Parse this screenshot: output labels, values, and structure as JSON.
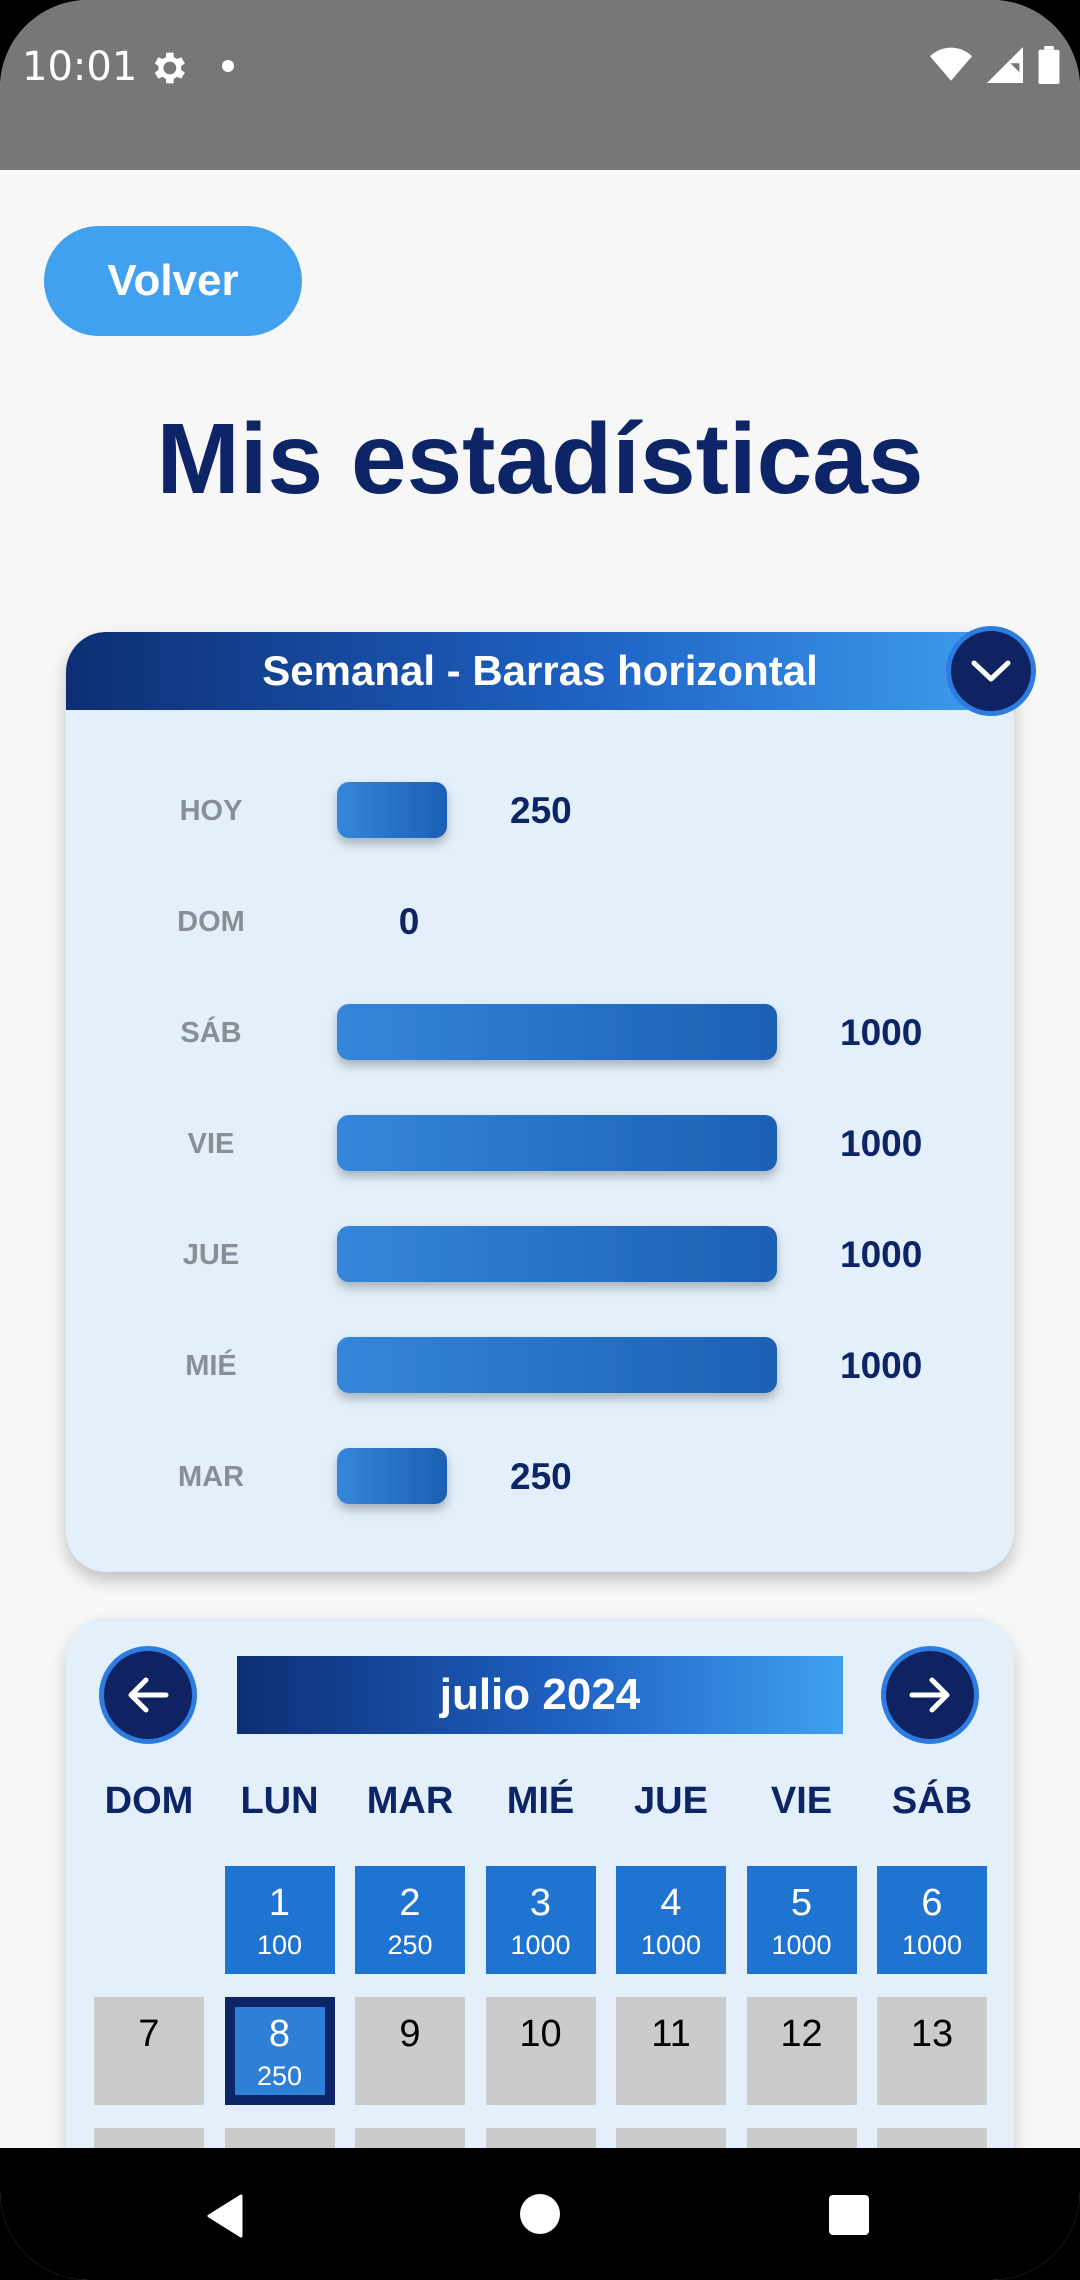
{
  "status": {
    "time": "10:01"
  },
  "header": {
    "back_label": "Volver",
    "title": "Mis estadísticas"
  },
  "weekly": {
    "title": "Semanal - Barras horizontal",
    "chart_data": {
      "type": "bar",
      "orientation": "horizontal",
      "categories": [
        "HOY",
        "DOM",
        "SÁB",
        "VIE",
        "JUE",
        "MIÉ",
        "MAR"
      ],
      "values": [
        250,
        0,
        1000,
        1000,
        1000,
        1000,
        250
      ],
      "xlim": [
        0,
        1000
      ],
      "bar_color": "#2a7bd5"
    }
  },
  "calendar": {
    "month": "julio 2024",
    "dow": [
      "DOM",
      "LUN",
      "MAR",
      "MIÉ",
      "JUE",
      "VIE",
      "SÁB"
    ],
    "days": [
      {
        "d": "1",
        "v": "100",
        "col": 1,
        "row": 0,
        "state": "active"
      },
      {
        "d": "2",
        "v": "250",
        "col": 2,
        "row": 0,
        "state": "active"
      },
      {
        "d": "3",
        "v": "1000",
        "col": 3,
        "row": 0,
        "state": "active"
      },
      {
        "d": "4",
        "v": "1000",
        "col": 4,
        "row": 0,
        "state": "active"
      },
      {
        "d": "5",
        "v": "1000",
        "col": 5,
        "row": 0,
        "state": "active"
      },
      {
        "d": "6",
        "v": "1000",
        "col": 6,
        "row": 0,
        "state": "active"
      },
      {
        "d": "7",
        "v": "",
        "col": 0,
        "row": 1,
        "state": "empty"
      },
      {
        "d": "8",
        "v": "250",
        "col": 1,
        "row": 1,
        "state": "today"
      },
      {
        "d": "9",
        "v": "",
        "col": 2,
        "row": 1,
        "state": "empty"
      },
      {
        "d": "10",
        "v": "",
        "col": 3,
        "row": 1,
        "state": "empty"
      },
      {
        "d": "11",
        "v": "",
        "col": 4,
        "row": 1,
        "state": "empty"
      },
      {
        "d": "12",
        "v": "",
        "col": 5,
        "row": 1,
        "state": "empty"
      },
      {
        "d": "13",
        "v": "",
        "col": 6,
        "row": 1,
        "state": "empty"
      },
      {
        "d": "",
        "v": "",
        "col": 0,
        "row": 2,
        "state": "empty"
      },
      {
        "d": "",
        "v": "",
        "col": 1,
        "row": 2,
        "state": "empty"
      },
      {
        "d": "",
        "v": "",
        "col": 2,
        "row": 2,
        "state": "empty"
      },
      {
        "d": "",
        "v": "",
        "col": 3,
        "row": 2,
        "state": "empty"
      },
      {
        "d": "",
        "v": "",
        "col": 4,
        "row": 2,
        "state": "empty"
      },
      {
        "d": "",
        "v": "",
        "col": 5,
        "row": 2,
        "state": "empty"
      },
      {
        "d": "",
        "v": "",
        "col": 6,
        "row": 2,
        "state": "empty"
      }
    ]
  }
}
